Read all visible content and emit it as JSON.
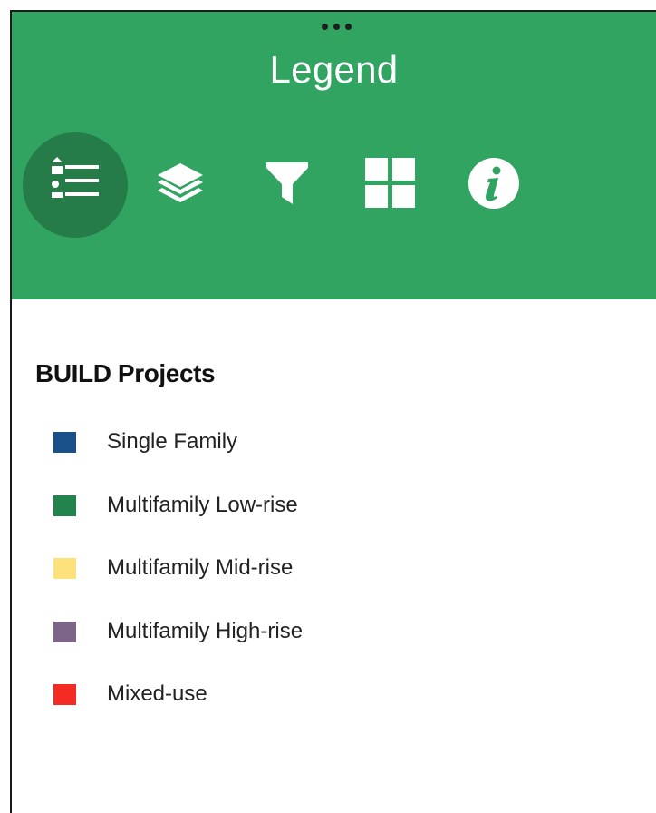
{
  "panel": {
    "title": "Legend",
    "handle_icon": "drag-handle-dots-icon"
  },
  "toolbar": {
    "active_tab": "legend",
    "tabs": [
      {
        "id": "legend",
        "icon": "list-icon",
        "active": true
      },
      {
        "id": "layers",
        "icon": "layers-icon",
        "active": false
      },
      {
        "id": "filter",
        "icon": "filter-icon",
        "active": false
      },
      {
        "id": "basemap",
        "icon": "grid-icon",
        "active": false
      },
      {
        "id": "info",
        "icon": "info-icon",
        "active": false
      }
    ]
  },
  "legend": {
    "section_title": "BUILD Projects",
    "items": [
      {
        "label": "Single Family",
        "color": "#1a5089"
      },
      {
        "label": "Multifamily Low-rise",
        "color": "#23834d"
      },
      {
        "label": "Multifamily Mid-rise",
        "color": "#fde17b"
      },
      {
        "label": "Multifamily High-rise",
        "color": "#7d6489"
      },
      {
        "label": "Mixed-use",
        "color": "#f42a24"
      }
    ]
  },
  "colors": {
    "header_bg": "#31a462",
    "active_tab_bg": "#257c48",
    "icon": "#ffffff"
  }
}
